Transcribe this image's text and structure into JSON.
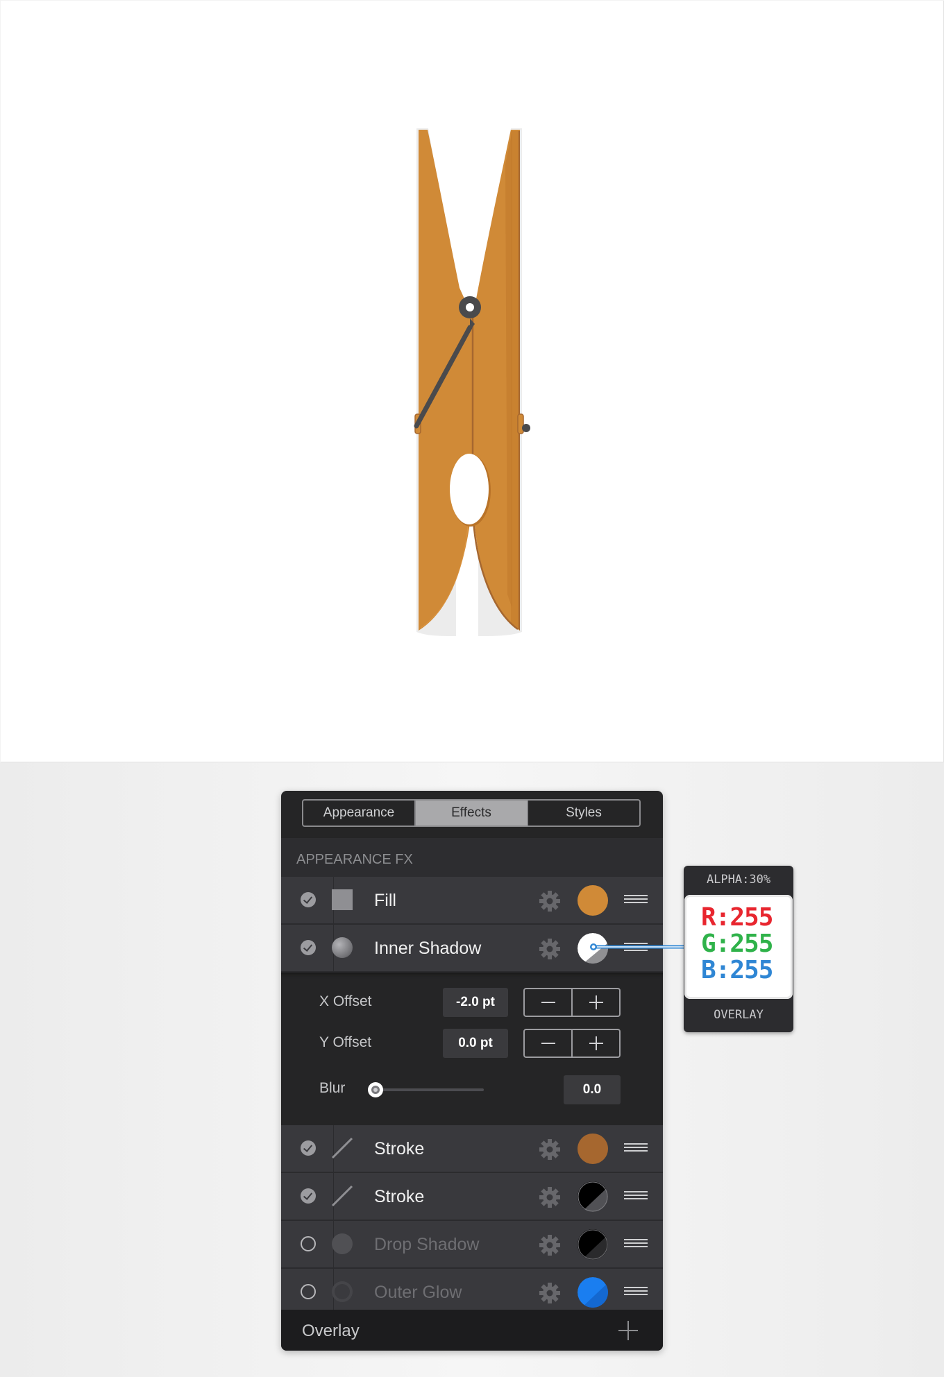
{
  "tabs": [
    {
      "label": "Appearance",
      "active": false
    },
    {
      "label": "Effects",
      "active": true
    },
    {
      "label": "Styles",
      "active": false
    }
  ],
  "section_title": "APPEARANCE FX",
  "effects": [
    {
      "label": "Fill",
      "enabled": true,
      "icon": "square-fill-icon",
      "color": "#d08a37"
    },
    {
      "label": "Inner Shadow",
      "enabled": true,
      "icon": "circle-shadow-icon",
      "color": "#ffffff"
    },
    {
      "label": "Stroke",
      "enabled": true,
      "icon": "line-stroke-icon",
      "color": "#a6672f"
    },
    {
      "label": "Stroke",
      "enabled": true,
      "icon": "line-stroke-icon",
      "color": "#000000"
    },
    {
      "label": "Drop Shadow",
      "enabled": false,
      "icon": "circle-shadow-icon",
      "color": "#000000"
    },
    {
      "label": "Outer Glow",
      "enabled": false,
      "icon": "circle-glow-icon",
      "color": "#1a7ef0"
    }
  ],
  "inner_shadow": {
    "x_offset_label": "X Offset",
    "x_offset_value": "-2.0 pt",
    "y_offset_label": "Y Offset",
    "y_offset_value": "0.0 pt",
    "blur_label": "Blur",
    "blur_value": "0.0"
  },
  "footer": {
    "label": "Overlay"
  },
  "color_popover": {
    "alpha": "ALPHA:30%",
    "r": "R:255",
    "g": "G:255",
    "b": "B:255",
    "blend": "OVERLAY",
    "r_color": "#e8262f",
    "g_color": "#2fb24a",
    "b_color": "#2f86d4"
  },
  "artwork": {
    "object": "clothespin",
    "body_color": "#d08a37",
    "edge_color": "#a6672f",
    "spring_color": "#4a4a4c"
  }
}
